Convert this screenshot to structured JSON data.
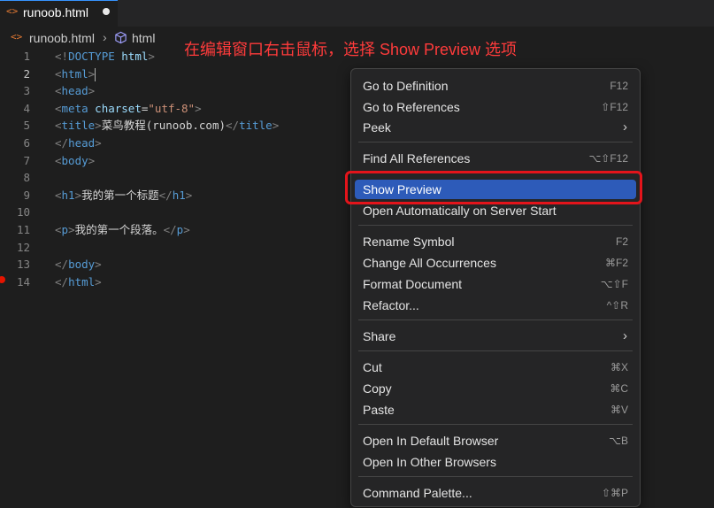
{
  "tab": {
    "icon": "html-file-icon",
    "icon_glyph": "<>",
    "title": "runoob.html",
    "dirty": true
  },
  "breadcrumb": {
    "file_icon_glyph": "<>",
    "file": "runoob.html",
    "sep": "›",
    "element": "html"
  },
  "annotation": "在编辑窗口右击鼠标，选择 Show Preview 选项",
  "editor": {
    "active_line": 2,
    "breakpoint_line": 14,
    "lines": [
      {
        "n": "1",
        "tokens": [
          [
            "t",
            "<!"
          ],
          [
            "dt",
            "DOCTYPE"
          ],
          [
            "attr",
            " html"
          ],
          [
            "t",
            ">"
          ]
        ]
      },
      {
        "n": "2",
        "tokens": [
          [
            "t",
            "<"
          ],
          [
            "tag",
            "html"
          ],
          [
            "t",
            ">"
          ]
        ]
      },
      {
        "n": "3",
        "tokens": [
          [
            "t",
            "<"
          ],
          [
            "tag",
            "head"
          ],
          [
            "t",
            ">"
          ]
        ]
      },
      {
        "n": "4",
        "tokens": [
          [
            "t",
            "<"
          ],
          [
            "tag",
            "meta"
          ],
          [
            "attr",
            " charset"
          ],
          [
            "txt",
            "="
          ],
          [
            "str",
            "\"utf-8\""
          ],
          [
            "t",
            ">"
          ]
        ]
      },
      {
        "n": "5",
        "tokens": [
          [
            "t",
            "<"
          ],
          [
            "tag",
            "title"
          ],
          [
            "t",
            ">"
          ],
          [
            "txt",
            "菜鸟教程(runoob.com)"
          ],
          [
            "t",
            "</"
          ],
          [
            "tag",
            "title"
          ],
          [
            "t",
            ">"
          ]
        ]
      },
      {
        "n": "6",
        "tokens": [
          [
            "t",
            "</"
          ],
          [
            "tag",
            "head"
          ],
          [
            "t",
            ">"
          ]
        ]
      },
      {
        "n": "7",
        "tokens": [
          [
            "t",
            "<"
          ],
          [
            "tag",
            "body"
          ],
          [
            "t",
            ">"
          ]
        ]
      },
      {
        "n": "8",
        "tokens": []
      },
      {
        "n": "9",
        "tokens": [
          [
            "t",
            "<"
          ],
          [
            "tag",
            "h1"
          ],
          [
            "t",
            ">"
          ],
          [
            "txt",
            "我的第一个标题"
          ],
          [
            "t",
            "</"
          ],
          [
            "tag",
            "h1"
          ],
          [
            "t",
            ">"
          ]
        ]
      },
      {
        "n": "10",
        "tokens": []
      },
      {
        "n": "11",
        "tokens": [
          [
            "t",
            "<"
          ],
          [
            "tag",
            "p"
          ],
          [
            "t",
            ">"
          ],
          [
            "txt",
            "我的第一个段落。"
          ],
          [
            "t",
            "</"
          ],
          [
            "tag",
            "p"
          ],
          [
            "t",
            ">"
          ]
        ]
      },
      {
        "n": "12",
        "tokens": []
      },
      {
        "n": "13",
        "tokens": [
          [
            "t",
            "</"
          ],
          [
            "tag",
            "body"
          ],
          [
            "t",
            ">"
          ]
        ]
      },
      {
        "n": "14",
        "tokens": [
          [
            "t",
            "</"
          ],
          [
            "tag",
            "html"
          ],
          [
            "t",
            ">"
          ]
        ]
      }
    ]
  },
  "context_menu": {
    "groups": [
      [
        {
          "label": "Go to Definition",
          "key": "F12"
        },
        {
          "label": "Go to References",
          "key": "⇧F12"
        },
        {
          "label": "Peek",
          "submenu": true
        }
      ],
      [
        {
          "label": "Find All References",
          "key": "⌥⇧F12"
        }
      ],
      [
        {
          "label": "Show Preview",
          "highlighted": true
        },
        {
          "label": "Open Automatically on Server Start"
        }
      ],
      [
        {
          "label": "Rename Symbol",
          "key": "F2"
        },
        {
          "label": "Change All Occurrences",
          "key": "⌘F2"
        },
        {
          "label": "Format Document",
          "key": "⌥⇧F"
        },
        {
          "label": "Refactor...",
          "key": "^⇧R"
        }
      ],
      [
        {
          "label": "Share",
          "submenu": true
        }
      ],
      [
        {
          "label": "Cut",
          "key": "⌘X"
        },
        {
          "label": "Copy",
          "key": "⌘C"
        },
        {
          "label": "Paste",
          "key": "⌘V"
        }
      ],
      [
        {
          "label": "Open In Default Browser",
          "key": "⌥B"
        },
        {
          "label": "Open In Other Browsers"
        }
      ],
      [
        {
          "label": "Command Palette...",
          "key": "⇧⌘P"
        }
      ]
    ]
  },
  "colors": {
    "highlight": "#2d5bb9",
    "annotation": "#ff3b3b",
    "focus_box": "#e3141b"
  }
}
